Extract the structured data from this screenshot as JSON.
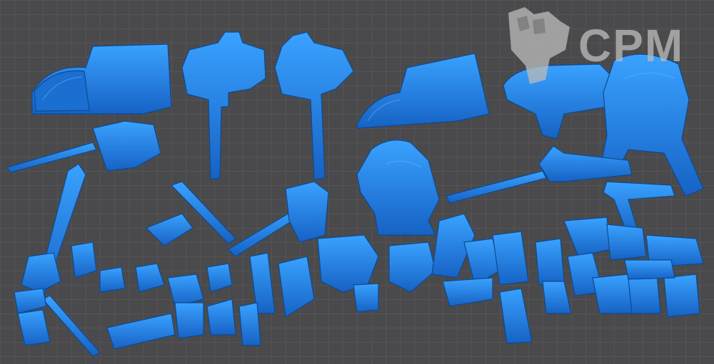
{
  "image": {
    "description_note": "",
    "watermark": {
      "text": "CPM",
      "icon": "raised-fist-icon"
    },
    "colors": {
      "background": "#4a4a4c",
      "grid": "#5c5c5f",
      "model": "#1f7fe0",
      "model_shadow": "#0f4f9a",
      "model_highlight": "#3aa2ff",
      "watermark": "#bdbdbd"
    }
  }
}
